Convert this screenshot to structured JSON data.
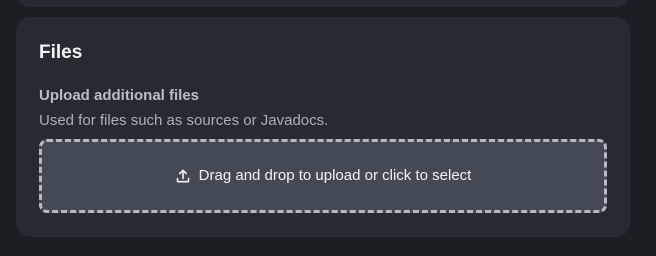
{
  "files_section": {
    "title": "Files",
    "upload_label": "Upload additional files",
    "upload_description": "Used for files such as sources or Javadocs.",
    "dropzone_text": "Drag and drop to upload or click to select",
    "dropzone_icon": "upload-icon"
  }
}
